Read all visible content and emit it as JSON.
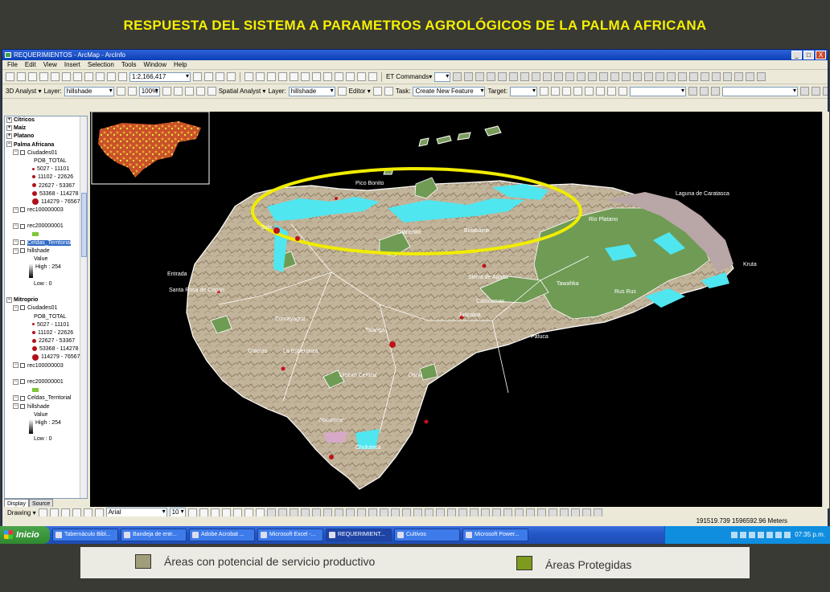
{
  "slide": {
    "title": "RESPUESTA DEL SISTEMA A PARAMETROS AGROLÓGICOS DE LA PALMA AFRICANA"
  },
  "window": {
    "title": "REQUERIMIENTOS - ArcMap - ArcInfo",
    "controls": [
      "_",
      "□",
      "X"
    ]
  },
  "menu": {
    "items": [
      "File",
      "Edit",
      "View",
      "Insert",
      "Selection",
      "Tools",
      "Window",
      "Help"
    ]
  },
  "toolbar1": {
    "scale": "1:2,166,417",
    "et_label": "ET Commands▾"
  },
  "toolbar2": {
    "analyst_label": "3D Analyst ▾",
    "layer_label": "Layer:",
    "layer_value": "hillshade",
    "zoom": "100%",
    "spatial_label": "Spatial Analyst ▾",
    "layer2_label": "Layer:",
    "layer2_value": "hillshade",
    "editor_label": "Editor ▾",
    "task_label": "Task:",
    "task_value": "Create New Feature",
    "target_label": "Target:"
  },
  "toc": {
    "rows": [
      {
        "kind": "group",
        "label": "Cítricos"
      },
      {
        "kind": "group",
        "label": "Maíz"
      },
      {
        "kind": "group",
        "label": "Platano"
      },
      {
        "kind": "group-open",
        "label": "Palma Africana"
      },
      {
        "kind": "layer",
        "label": "Ciudades01"
      },
      {
        "kind": "field",
        "label": "POB_TOTAL"
      },
      {
        "kind": "class",
        "label": "5027 - 11101",
        "size": 3
      },
      {
        "kind": "class",
        "label": "11102 - 22626",
        "size": 4
      },
      {
        "kind": "class",
        "label": "22627 - 53367",
        "size": 5
      },
      {
        "kind": "class",
        "label": "53368 - 114278",
        "size": 6
      },
      {
        "kind": "class",
        "label": "114279 - 765675",
        "size": 8
      },
      {
        "kind": "layer",
        "label": "rec100000003"
      },
      {
        "kind": "blank",
        "label": ""
      },
      {
        "kind": "layer",
        "label": "rec200000001"
      },
      {
        "kind": "patch",
        "label": ""
      },
      {
        "kind": "layer-sel",
        "label": "Celdas_Territorial"
      },
      {
        "kind": "layer",
        "label": "hillshade"
      },
      {
        "kind": "field",
        "label": "Value"
      },
      {
        "kind": "ramp",
        "label": "High : 254"
      },
      {
        "kind": "blank",
        "label": ""
      },
      {
        "kind": "field",
        "label": "Low : 0"
      },
      {
        "kind": "blank",
        "label": ""
      },
      {
        "kind": "group-open",
        "label": "Mitroprio"
      },
      {
        "kind": "layer",
        "label": "Ciudades01"
      },
      {
        "kind": "field",
        "label": "POB_TOTAL"
      },
      {
        "kind": "class",
        "label": "5027 - 11101",
        "size": 3
      },
      {
        "kind": "class",
        "label": "11102 - 22626",
        "size": 4
      },
      {
        "kind": "class",
        "label": "22627 - 53367",
        "size": 5
      },
      {
        "kind": "class",
        "label": "53368 - 114278",
        "size": 6
      },
      {
        "kind": "class",
        "label": "114279 - 765675",
        "size": 8
      },
      {
        "kind": "layer",
        "label": "rec100000003"
      },
      {
        "kind": "blank",
        "label": ""
      },
      {
        "kind": "layer",
        "label": "rec200000001"
      },
      {
        "kind": "patch",
        "label": ""
      },
      {
        "kind": "layer",
        "label": "Celdas_Territorial"
      },
      {
        "kind": "layer",
        "label": "hillshade"
      },
      {
        "kind": "field",
        "label": "Value"
      },
      {
        "kind": "ramp",
        "label": "High : 254"
      },
      {
        "kind": "blank",
        "label": ""
      },
      {
        "kind": "field",
        "label": "Low : 0"
      }
    ],
    "tabs": [
      "Display",
      "Source"
    ]
  },
  "map": {
    "labels": [
      {
        "text": "Pico Bonito"
      },
      {
        "text": "Laguna de Caratasca"
      },
      {
        "text": "Rio Platano"
      },
      {
        "text": "Olanchito"
      },
      {
        "text": "Belabarrie"
      },
      {
        "text": "Sula"
      },
      {
        "text": "Sierra de Agalta"
      },
      {
        "text": "Tawahka"
      },
      {
        "text": "Rus Rus"
      },
      {
        "text": "Kruta"
      },
      {
        "text": "Catacamas"
      },
      {
        "text": "Juticalpa"
      },
      {
        "text": "Patuca"
      },
      {
        "text": "Comayagua"
      },
      {
        "text": "Talanga"
      },
      {
        "text": "Distrito Central"
      },
      {
        "text": "Danlí"
      },
      {
        "text": "Choluteca"
      },
      {
        "text": "Nacaome"
      },
      {
        "text": "Entrada"
      },
      {
        "text": "Santa Rosa de Copán"
      },
      {
        "text": "Gracias"
      },
      {
        "text": "La Esperanza"
      }
    ]
  },
  "drawbar": {
    "label": "Drawing ▾",
    "font": "Arial",
    "size": "10"
  },
  "status": {
    "coords": "191519.739  1596592.96 Meters"
  },
  "taskbar": {
    "start": "Inicio",
    "tasks": [
      "Tabernáculo Bibl...",
      "Bandeja de entr...",
      "Adobe Acrobat ...",
      "Microsoft Excel -...",
      "REQUERIMIENT...",
      "Cultivos",
      "Microsoft Power..."
    ],
    "clock": "07:35 p.m."
  },
  "legend": {
    "items": [
      {
        "label": "Áreas con potencial de servicio productivo",
        "color": "#a09e7a"
      },
      {
        "label": "Áreas Protegidas",
        "color": "#7e9b1e"
      }
    ]
  },
  "colors": {
    "title_yellow": "#f5f000",
    "potential_cyan": "#4fe6f0",
    "protected_green": "#6f9b55",
    "highlight_ellipse": "#f0ec00"
  }
}
